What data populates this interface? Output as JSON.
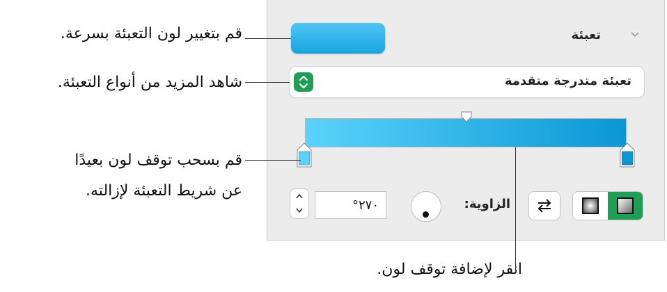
{
  "callouts": {
    "quick_color": "قم بتغيير لون التعبئة بسرعة.",
    "more_fills": "شاهد المزيد من أنواع التعبئة.",
    "drag_stop_line1": "قم بسحب توقف لون بعيدًا",
    "drag_stop_line2": "عن شريط التعبئة لإزالته.",
    "add_stop": "انقر لإضافة توقف لون."
  },
  "panel": {
    "section_title": "تعبئة",
    "fill_type_value": "تعبئة متدرجة متقدمة",
    "angle_label": "الزاوية:",
    "angle_value": "٢٧٠°"
  },
  "colors": {
    "fill_light": "#5ad3fc",
    "fill_dark": "#0a97d4",
    "accent_green": "#1f9f55",
    "stop_left": "#5ad3fc",
    "stop_right": "#0a97d4"
  },
  "icons": [
    "chevron-down-icon",
    "up-down-arrows-icon",
    "swap-arrows-icon",
    "radial-gradient-icon",
    "linear-gradient-icon"
  ]
}
